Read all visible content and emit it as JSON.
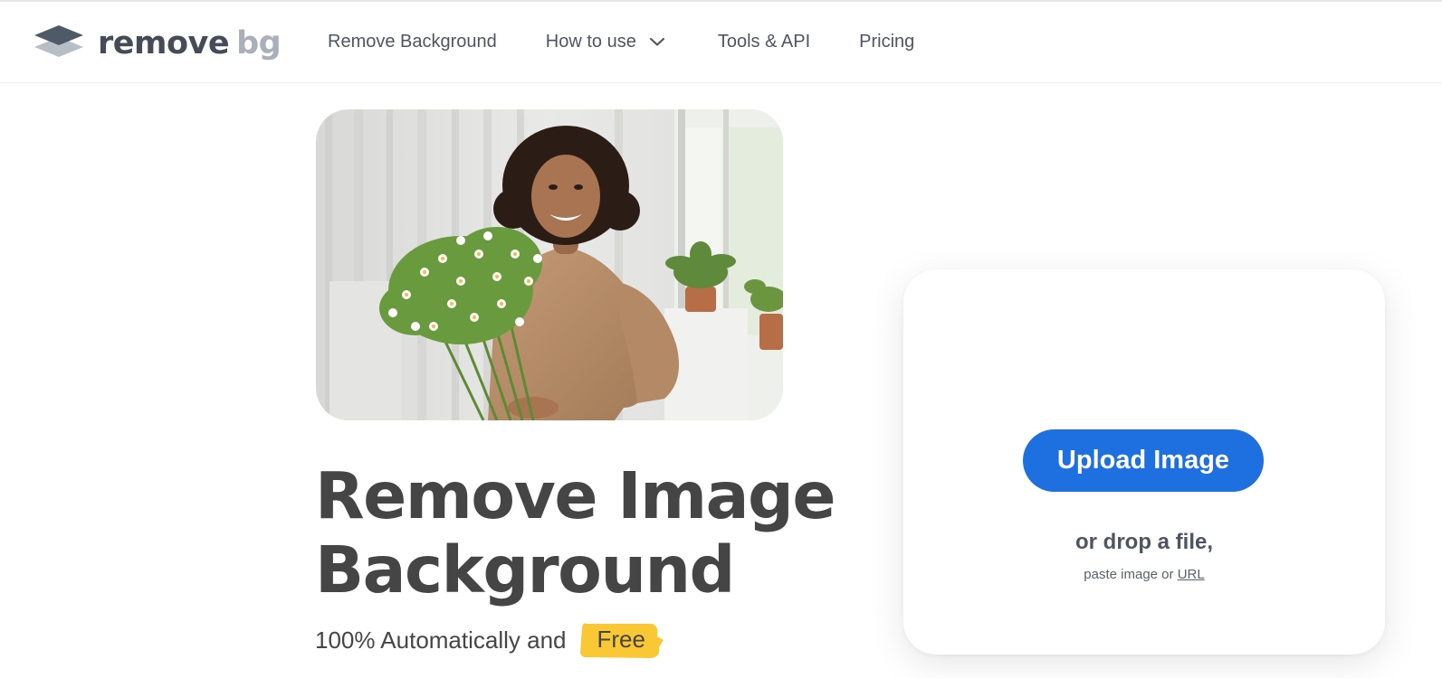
{
  "header": {
    "logo": {
      "word1": "remove",
      "word2": "bg",
      "icon": "layers-icon"
    },
    "nav": [
      {
        "label": "Remove Background"
      },
      {
        "label": "How to use",
        "icon": "chevron-down-icon"
      },
      {
        "label": "Tools & API"
      },
      {
        "label": "Pricing"
      }
    ]
  },
  "hero": {
    "image_subject": "woman-holding-flower-bouquet",
    "title_line1": "Remove Image",
    "title_line2": "Background",
    "subtitle": "100% Automatically and",
    "badge": "Free"
  },
  "upload": {
    "button_label": "Upload Image",
    "drop_text": "or drop a file,",
    "paste_text": "paste image or",
    "url_link": "URL"
  },
  "colors": {
    "accent_blue": "#1e6fe0",
    "badge_yellow": "#fbc835",
    "title_text": "#454545",
    "logo_dark": "#454c57",
    "logo_light": "#a9b0b9"
  }
}
